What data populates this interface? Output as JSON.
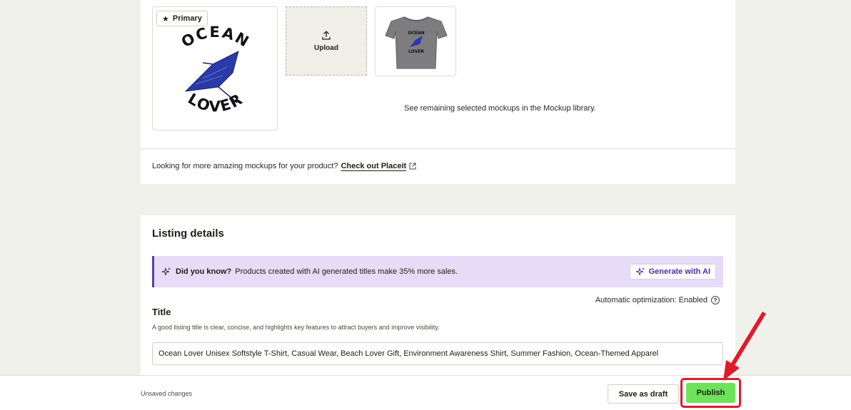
{
  "mockups": {
    "primary_badge": "Primary",
    "upload_label": "Upload",
    "design_text_top": "OCEAN",
    "design_text_bottom": "LOVER",
    "remaining_text": "See remaining selected mockups in the Mockup library.",
    "placeit_prompt": "Looking for more amazing mockups for your product?",
    "placeit_link": "Check out Placeit"
  },
  "listing": {
    "section_title": "Listing details",
    "ai_banner": {
      "bold_text": "Did you know?",
      "text": "Products created with AI generated titles make 35% more sales.",
      "button_label": "Generate with AI"
    },
    "auto_optimization": "Automatic optimization: Enabled",
    "title_label": "Title",
    "title_hint": "A good listing title is clear, concise, and highlights key features to attract buyers and improve visibility.",
    "title_value": "Ocean Lover Unisex Softstyle T-Shirt, Casual Wear, Beach Lover Gift, Environment Awareness Shirt, Summer Fashion, Ocean-Themed Apparel"
  },
  "footer": {
    "status": "Unsaved changes",
    "save_draft_label": "Save as draft",
    "publish_label": "Publish"
  },
  "icons": {
    "star": "star-icon",
    "upload": "upload-icon",
    "external": "external-link-icon",
    "sparkle": "sparkle-icon",
    "help": "help-icon"
  },
  "colors": {
    "page_bg": "#f1f1eb",
    "ai_banner_bg": "#e6dcf7",
    "ai_accent": "#5b3ea6",
    "publish_bg": "#6fe25c",
    "highlight_red": "#e01a2d"
  }
}
